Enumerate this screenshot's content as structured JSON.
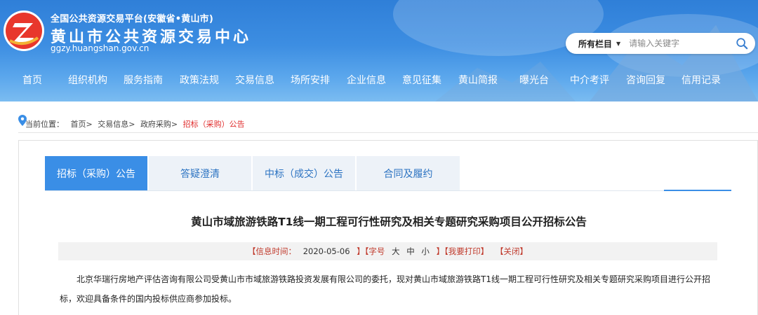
{
  "header": {
    "top_line": "全国公共资源交易平台(安徽省•黄山市)",
    "site_name": "黄山市公共资源交易中心",
    "url": "ggzy.huangshan.gov.cn",
    "logo_icon": "z-logo-icon"
  },
  "search": {
    "category": "所有栏目",
    "placeholder": "请输入关键字",
    "icon": "search-icon"
  },
  "nav": {
    "items": [
      "首页",
      "组织机构",
      "服务指南",
      "政策法规",
      "交易信息",
      "场所安排",
      "企业信息",
      "意见征集",
      "黄山简报",
      "曝光台",
      "中介考评",
      "咨询回复",
      "信用记录"
    ]
  },
  "breadcrumb": {
    "label": "当前位置：",
    "items": [
      "首页>",
      "交易信息>",
      "政府采购>"
    ],
    "current": "招标（采购）公告"
  },
  "tabs": [
    "招标（采购）公告",
    "答疑澄清",
    "中标（成交）公告",
    "合同及履约"
  ],
  "article": {
    "title": "黄山市域旅游铁路T1线一期工程可行性研究及相关专题研究采购项目公开招标公告",
    "info_time_label": "【信息时间：",
    "info_time": "2020-05-06",
    "font_size_label": "】【字号",
    "font_large": "大",
    "font_medium": "中",
    "font_small": "小",
    "print": "】【我要打印】",
    "close": "【关闭】",
    "paragraph": "北京华瑞行房地产评估咨询有限公司受黄山市市域旅游铁路投资发展有限公司的委托，现对黄山市域旅游铁路T1线一期工程可行性研究及相关专题研究采购项目进行公开招标，欢迎具备条件的国内投标供应商参加投标。"
  },
  "colors": {
    "header_blue": "#3d8ee2",
    "tab_active": "#3a8ee6",
    "tab_inactive_bg": "#edf2f8",
    "tab_text": "#2c73c2",
    "crumb_current": "#e02c2c"
  }
}
